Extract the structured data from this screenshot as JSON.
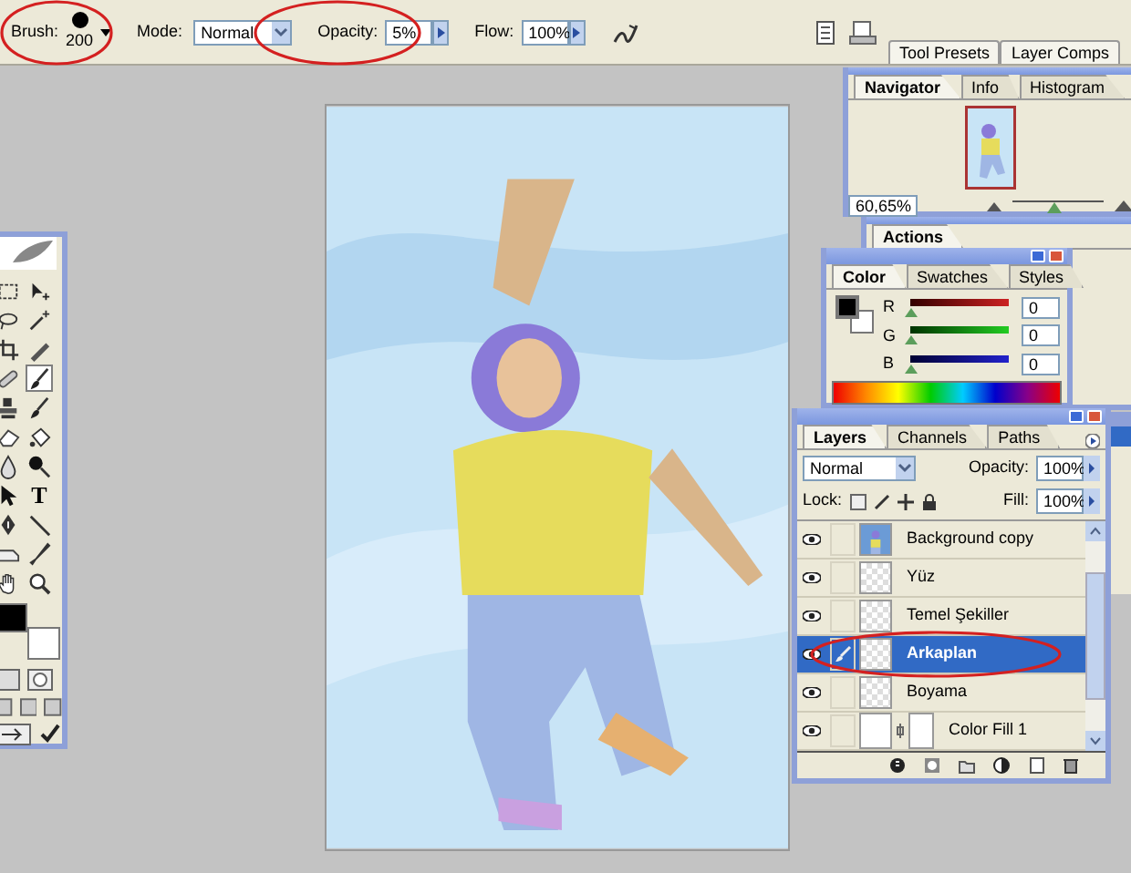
{
  "options_bar": {
    "brush": {
      "label": "Brush:",
      "size": "200",
      "circled": true
    },
    "mode": {
      "label": "Mode:",
      "value": "Normal"
    },
    "opacity": {
      "label": "Opacity:",
      "value": "5%",
      "circled": true
    },
    "flow": {
      "label": "Flow:",
      "value": "100%"
    },
    "palette_tabs": [
      {
        "label": "Tool Presets"
      },
      {
        "label": "Layer Comps"
      }
    ]
  },
  "toolbox": {
    "tools": [
      {
        "kind": "marquee",
        "selected": false
      },
      {
        "kind": "move",
        "selected": false
      },
      {
        "kind": "lasso",
        "selected": false
      },
      {
        "kind": "wand",
        "selected": false
      },
      {
        "kind": "crop",
        "selected": false
      },
      {
        "kind": "slice",
        "selected": false
      },
      {
        "kind": "bandage",
        "selected": false
      },
      {
        "kind": "brush",
        "selected": true
      },
      {
        "kind": "stamp",
        "selected": false
      },
      {
        "kind": "brush",
        "selected": false
      },
      {
        "kind": "eraser",
        "selected": false
      },
      {
        "kind": "bucket",
        "selected": false
      },
      {
        "kind": "drop",
        "selected": false
      },
      {
        "kind": "dodge",
        "selected": false
      },
      {
        "kind": "arrow",
        "selected": false
      },
      {
        "kind": "type",
        "glyph": "T",
        "selected": false
      },
      {
        "kind": "pen",
        "selected": false
      },
      {
        "kind": "line",
        "selected": false
      },
      {
        "kind": "note",
        "selected": false
      },
      {
        "kind": "eyedropper",
        "selected": false
      },
      {
        "kind": "hand",
        "selected": false
      },
      {
        "kind": "zoom",
        "selected": false
      }
    ]
  },
  "navigator": {
    "tabs": [
      {
        "label": "Navigator",
        "selected": true
      },
      {
        "label": "Info",
        "selected": false
      },
      {
        "label": "Histogram",
        "selected": false
      }
    ],
    "zoom": "60,65%",
    "level": 0.45
  },
  "actions": {
    "tabs": [
      {
        "label": "Actions",
        "selected": true
      }
    ]
  },
  "color": {
    "tabs": [
      {
        "label": "Color",
        "selected": true
      },
      {
        "label": "Swatches",
        "selected": false
      },
      {
        "label": "Styles",
        "selected": false
      }
    ],
    "channels": [
      {
        "label": "R",
        "value": "0",
        "level": 0
      },
      {
        "label": "G",
        "value": "0",
        "level": 0
      },
      {
        "label": "B",
        "value": "0",
        "level": 0
      }
    ]
  },
  "layers": {
    "tabs": [
      {
        "label": "Layers",
        "selected": true
      },
      {
        "label": "Channels",
        "selected": false
      },
      {
        "label": "Paths",
        "selected": false
      }
    ],
    "blend_mode": "Normal",
    "opacity": {
      "label": "Opacity:",
      "value": "100%"
    },
    "lock_label": "Lock:",
    "fill": {
      "label": "Fill:",
      "value": "100%"
    },
    "items": [
      {
        "name": "Background copy",
        "visible": true,
        "selected": false,
        "circled": false
      },
      {
        "name": "Yüz",
        "kind": "layer",
        "visible": true,
        "selected": false,
        "circled": false
      },
      {
        "name": "Temel Şekiller",
        "kind": "layer",
        "visible": true,
        "selected": false,
        "circled": false
      },
      {
        "name": "Arkaplan",
        "kind": "layer",
        "visible": true,
        "selected": true,
        "circled": true
      },
      {
        "name": "Boyama",
        "kind": "layer",
        "visible": true,
        "selected": false,
        "circled": false
      },
      {
        "name": "Color Fill 1",
        "kind": "fill",
        "visible": true,
        "selected": false,
        "circled": false
      }
    ]
  }
}
